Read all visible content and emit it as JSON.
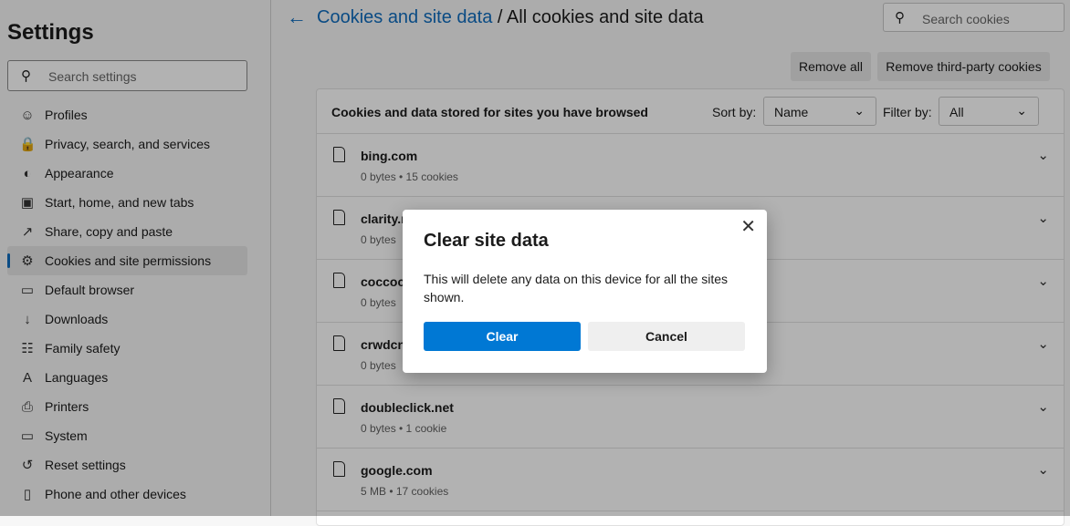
{
  "sidebar": {
    "title": "Settings",
    "search_placeholder": "Search settings",
    "items": [
      {
        "label": "Profiles",
        "icon": "profile-icon",
        "glyph": "☺"
      },
      {
        "label": "Privacy, search, and services",
        "icon": "lock-icon",
        "glyph": "🔒"
      },
      {
        "label": "Appearance",
        "icon": "palette-icon",
        "glyph": "◐"
      },
      {
        "label": "Start, home, and new tabs",
        "icon": "start-tab-icon",
        "glyph": "▣"
      },
      {
        "label": "Share, copy and paste",
        "icon": "share-icon",
        "glyph": "↗"
      },
      {
        "label": "Cookies and site permissions",
        "icon": "cookies-icon",
        "glyph": "⚙",
        "active": true
      },
      {
        "label": "Default browser",
        "icon": "browser-icon",
        "glyph": "▭"
      },
      {
        "label": "Downloads",
        "icon": "download-icon",
        "glyph": "↓"
      },
      {
        "label": "Family safety",
        "icon": "family-icon",
        "glyph": "☷"
      },
      {
        "label": "Languages",
        "icon": "language-icon",
        "glyph": "A"
      },
      {
        "label": "Printers",
        "icon": "printer-icon",
        "glyph": "⎙"
      },
      {
        "label": "System",
        "icon": "system-icon",
        "glyph": "▭"
      },
      {
        "label": "Reset settings",
        "icon": "reset-icon",
        "glyph": "↺"
      },
      {
        "label": "Phone and other devices",
        "icon": "phone-icon",
        "glyph": "▯"
      }
    ]
  },
  "header": {
    "breadcrumb_link": "Cookies and site data",
    "breadcrumb_current": " / All cookies and site data",
    "search_placeholder": "Search cookies"
  },
  "actions": {
    "remove_all": "Remove all",
    "remove_third_party": "Remove third-party cookies"
  },
  "card": {
    "heading": "Cookies and data stored for sites you have browsed",
    "sort_label": "Sort by:",
    "sort_value": "Name",
    "filter_label": "Filter by:",
    "filter_value": "All"
  },
  "sites": [
    {
      "name": "bing.com",
      "details": "0 bytes • 15 cookies"
    },
    {
      "name": "clarity.ms",
      "details": "0 bytes"
    },
    {
      "name": "coccoc.com",
      "details": "0 bytes"
    },
    {
      "name": "crwdcntrl.net",
      "details": "0 bytes"
    },
    {
      "name": "doubleclick.net",
      "details": "0 bytes • 1 cookie"
    },
    {
      "name": "google.com",
      "details": "5 MB • 17 cookies"
    }
  ],
  "dialog": {
    "title": "Clear site data",
    "message": "This will delete any data on this device for all the sites shown.",
    "confirm": "Clear",
    "cancel": "Cancel",
    "close": "✕"
  },
  "colors": {
    "accent": "#0078d4",
    "link": "#0f6cbd"
  }
}
